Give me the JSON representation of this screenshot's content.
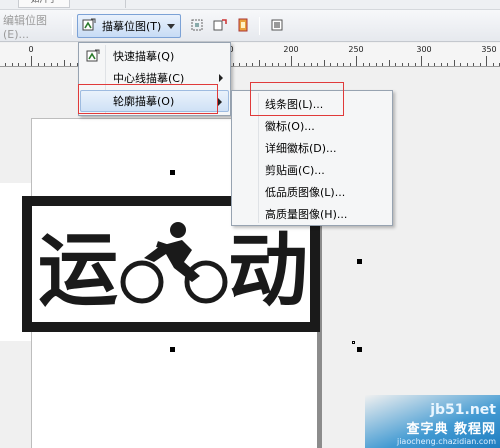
{
  "top_menu": {
    "partial_label": "如片了"
  },
  "toolbar": {
    "edit_bitmap_label": "编辑位图(E)...",
    "trace_bitmap_label": "描摹位图(T)"
  },
  "ruler": {
    "labels": [
      "0",
      "50",
      "100",
      "150",
      "200",
      "250",
      "300",
      "350"
    ]
  },
  "trace_menu": {
    "items": [
      {
        "label": "快速描摹(Q)",
        "icon": "trace-bitmap-icon",
        "has_submenu": false
      },
      {
        "label": "中心线描摹(C)",
        "icon": "",
        "has_submenu": true
      },
      {
        "label": "轮廓描摹(O)",
        "icon": "",
        "has_submenu": true,
        "highlighted": true
      }
    ]
  },
  "outline_submenu": {
    "items": [
      {
        "label": "线条图(L)..."
      },
      {
        "label": "徽标(O)..."
      },
      {
        "label": "详细徽标(D)..."
      },
      {
        "label": "剪贴画(C)..."
      },
      {
        "label": "低品质图像(L)..."
      },
      {
        "label": "高质量图像(H)..."
      }
    ]
  },
  "logo": {
    "text_left": "运",
    "text_right": "动"
  },
  "watermark": {
    "site": "jb51.net",
    "title": "查字典 教程网",
    "url": "jiaocheng.chazidian.com"
  },
  "colors": {
    "highlight_border": "#e03a3a",
    "menu_hover": "#cfe1f6",
    "logo_ink": "#1a1a1a",
    "watermark_blue": "#248bcd"
  }
}
